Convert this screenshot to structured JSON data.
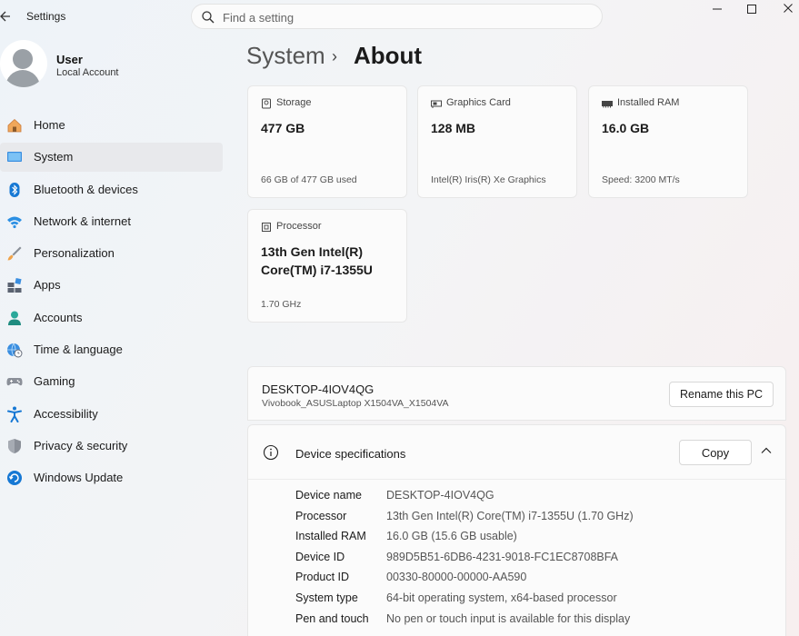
{
  "window": {
    "app_title": "Settings",
    "search_placeholder": "Find a setting"
  },
  "profile": {
    "name": "User",
    "account_type": "Local Account"
  },
  "sidebar": {
    "items": [
      {
        "label": "Home",
        "icon": "home-icon",
        "active": false
      },
      {
        "label": "System",
        "icon": "system-icon",
        "active": true
      },
      {
        "label": "Bluetooth & devices",
        "icon": "bluetooth-icon",
        "active": false
      },
      {
        "label": "Network & internet",
        "icon": "wifi-icon",
        "active": false
      },
      {
        "label": "Personalization",
        "icon": "brush-icon",
        "active": false
      },
      {
        "label": "Apps",
        "icon": "apps-icon",
        "active": false
      },
      {
        "label": "Accounts",
        "icon": "accounts-icon",
        "active": false
      },
      {
        "label": "Time & language",
        "icon": "globe-clock-icon",
        "active": false
      },
      {
        "label": "Gaming",
        "icon": "gamepad-icon",
        "active": false
      },
      {
        "label": "Accessibility",
        "icon": "accessibility-icon",
        "active": false
      },
      {
        "label": "Privacy & security",
        "icon": "shield-icon",
        "active": false
      },
      {
        "label": "Windows Update",
        "icon": "update-icon",
        "active": false
      }
    ]
  },
  "breadcrumb": {
    "parent": "System",
    "separator": "›",
    "current": "About"
  },
  "cards": {
    "storage": {
      "title": "Storage",
      "value": "477 GB",
      "sub": "66 GB of 477 GB used"
    },
    "graphics": {
      "title": "Graphics Card",
      "value": "128 MB",
      "sub": "Intel(R) Iris(R) Xe Graphics"
    },
    "ram": {
      "title": "Installed RAM",
      "value": "16.0 GB",
      "sub": "Speed: 3200 MT/s"
    },
    "processor": {
      "title": "Processor",
      "value": "13th Gen Intel(R) Core(TM) i7-1355U",
      "sub": "1.70 GHz"
    }
  },
  "pc": {
    "name": "DESKTOP-4IOV4QG",
    "model": "Vivobook_ASUSLaptop X1504VA_X1504VA",
    "rename_label": "Rename this PC"
  },
  "specs": {
    "title": "Device specifications",
    "copy_label": "Copy",
    "rows": [
      {
        "key": "Device name",
        "value": "DESKTOP-4IOV4QG"
      },
      {
        "key": "Processor",
        "value": "13th Gen Intel(R) Core(TM) i7-1355U (1.70 GHz)"
      },
      {
        "key": "Installed RAM",
        "value": "16.0 GB (15.6 GB usable)"
      },
      {
        "key": "Device ID",
        "value": "989D5B51-6DB6-4231-9018-FC1EC8708BFA"
      },
      {
        "key": "Product ID",
        "value": "00330-80000-00000-AA590"
      },
      {
        "key": "System type",
        "value": "64-bit operating system, x64-based processor"
      },
      {
        "key": "Pen and touch",
        "value": "No pen or touch input is available for this display"
      }
    ]
  },
  "colors": {
    "accent": "#0067c0",
    "active_nav_bg": "#e8e9ec"
  }
}
